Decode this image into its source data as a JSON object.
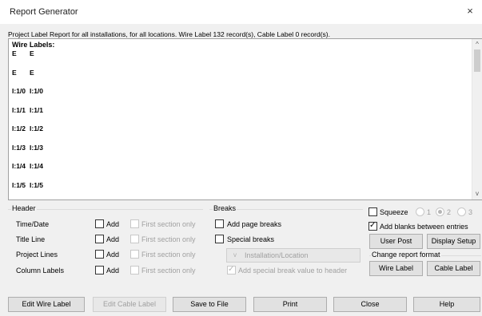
{
  "window": {
    "title": "Report Generator",
    "close": "×"
  },
  "summary": "Project Label Report for all installations, for all locations. Wire Label 132 record(s), Cable Label 0 record(s).",
  "report": {
    "heading": "Wire Labels:",
    "rows": [
      [
        "E",
        "E"
      ],
      [
        "E",
        "E"
      ],
      [
        "I:1/0",
        "I:1/0"
      ],
      [
        "I:1/1",
        "I:1/1"
      ],
      [
        "I:1/2",
        "I:1/2"
      ],
      [
        "I:1/3",
        "I:1/3"
      ],
      [
        "I:1/4",
        "I:1/4"
      ],
      [
        "I:1/5",
        "I:1/5"
      ]
    ]
  },
  "header_group": {
    "title": "Header",
    "rows": [
      {
        "label": "Time/Date",
        "add": "Add",
        "first": "First section only"
      },
      {
        "label": "Title Line",
        "add": "Add",
        "first": "First section only"
      },
      {
        "label": "Project Lines",
        "add": "Add",
        "first": "First section only"
      },
      {
        "label": "Column Labels",
        "add": "Add",
        "first": "First section only"
      }
    ]
  },
  "breaks_group": {
    "title": "Breaks",
    "page_breaks": "Add page breaks",
    "special_breaks": "Special breaks",
    "combo_value": "Installation/Location",
    "special_value": "Add special break value to header"
  },
  "right_panel": {
    "squeeze": "Squeeze",
    "radio_1": "1",
    "radio_2": "2",
    "radio_3": "3",
    "add_blanks": "Add blanks between entries",
    "user_post": "User Post",
    "display_setup": "Display Setup",
    "change_format": "Change report format",
    "wire_label": "Wire Label",
    "cable_label": "Cable Label"
  },
  "footer": {
    "edit_wire": "Edit Wire Label",
    "edit_cable": "Edit Cable Label",
    "save": "Save to File",
    "print": "Print",
    "close": "Close",
    "help": "Help"
  },
  "icons": {
    "scroll_up": "^",
    "scroll_down": "v",
    "combo_arrow": "v"
  }
}
